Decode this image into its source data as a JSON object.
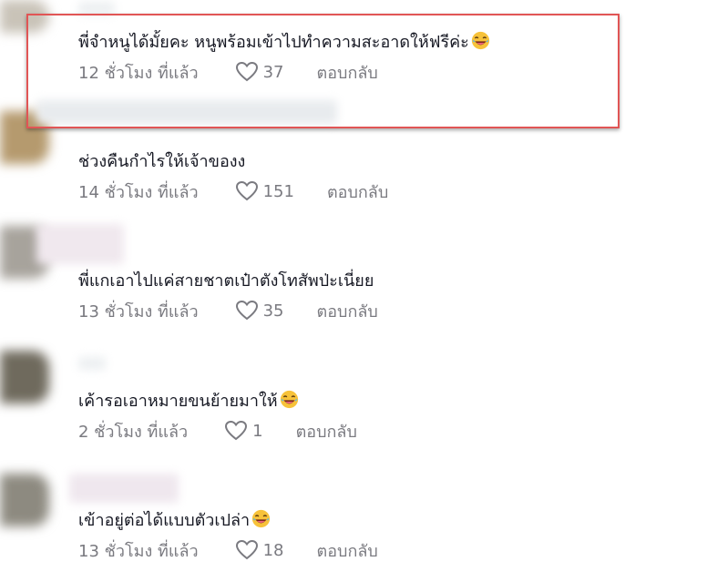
{
  "comments": [
    {
      "text": "พี่จำหนูได้มั้ยคะ หนูพร้อมเข้าไปทำความสะอาดให้ฟรีค่ะ",
      "emoji": "laughing-face",
      "time": "12 ชั่วโมง ที่แล้ว",
      "likes": "37",
      "reply": "ตอบกลับ",
      "highlighted": true
    },
    {
      "text": "ช่วงคืนกำไรให้เจ้าของง",
      "emoji": "",
      "time": "14 ชั่วโมง ที่แล้ว",
      "likes": "151",
      "reply": "ตอบกลับ",
      "highlighted": false
    },
    {
      "text": "พี่แกเอาไปแค่สายชาตเป๋าตังโทสัพป่ะเนี่ยย",
      "emoji": "",
      "time": "13 ชั่วโมง ที่แล้ว",
      "likes": "35",
      "reply": "ตอบกลับ",
      "highlighted": false
    },
    {
      "text": "เค้ารอเอาหมายขนย้ายมาให้",
      "emoji": "laughing-face",
      "time": "2 ชั่วโมง ที่แล้ว",
      "likes": "1",
      "reply": "ตอบกลับ",
      "highlighted": false
    },
    {
      "text": "เข้าอยู่ต่อได้แบบตัวเปล่า",
      "emoji": "laughing-face",
      "time": "13 ชั่วโมง ที่แล้ว",
      "likes": "18",
      "reply": "ตอบกลับ",
      "highlighted": false
    }
  ],
  "colors": {
    "highlight_border": "#e15555",
    "text": "#161823",
    "meta": "#7a7a80"
  }
}
